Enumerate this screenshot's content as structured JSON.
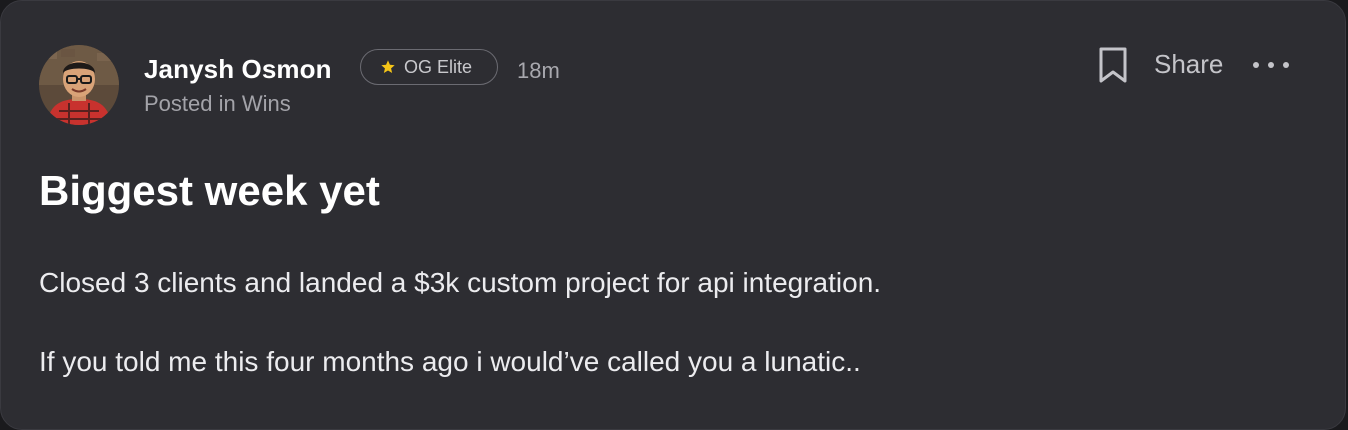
{
  "post": {
    "author": {
      "name": "Janysh Osmon",
      "avatar_icon": "user-avatar-photo"
    },
    "badge": {
      "icon": "star-icon",
      "icon_color": "#f5c518",
      "label": "OG Elite"
    },
    "timestamp": "18m",
    "posted_in": "Posted in Wins",
    "actions": {
      "bookmark_icon": "bookmark-icon",
      "share_label": "Share",
      "more_icon": "more-horizontal-icon"
    },
    "title": "Biggest week yet",
    "body": [
      "Closed 3 clients and landed a $3k custom project for api integration.",
      "If you told me this four months ago i would’ve called you a lunatic.."
    ]
  },
  "colors": {
    "card_background": "#2d2d32",
    "page_background": "#1a1a1d",
    "text_primary": "#ffffff",
    "text_secondary": "#a3a3a9"
  }
}
